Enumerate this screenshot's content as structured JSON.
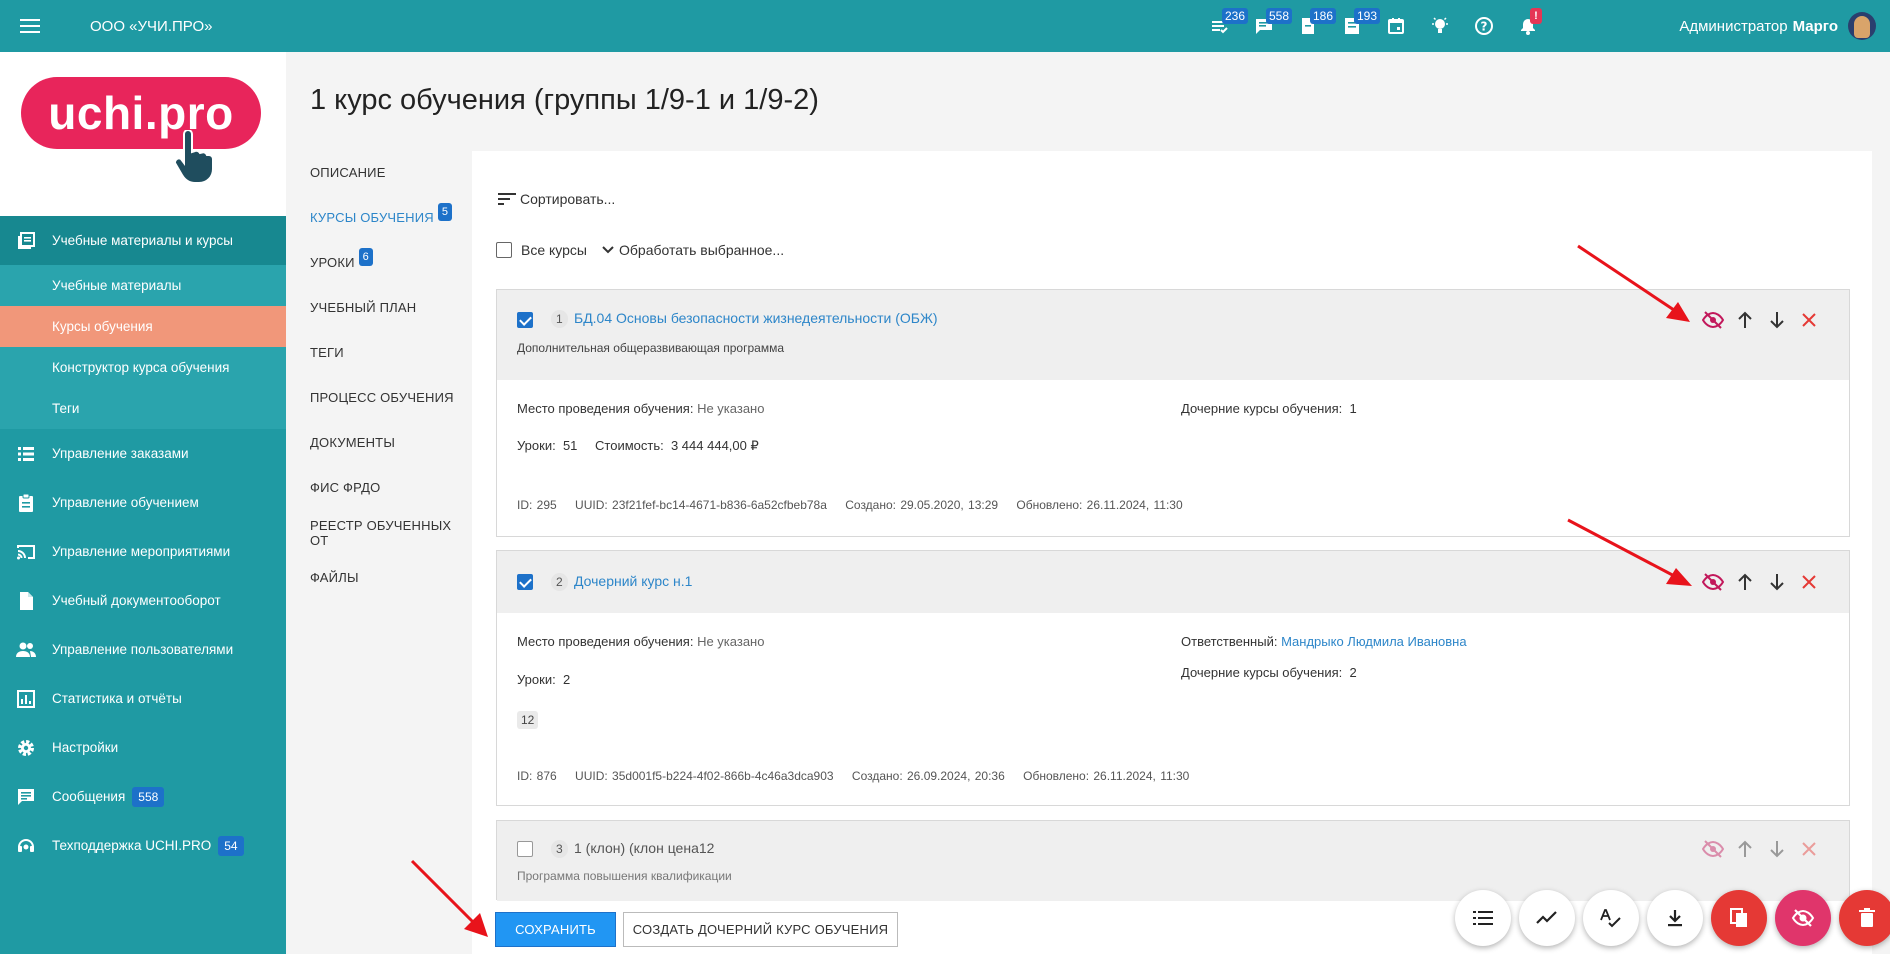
{
  "header": {
    "org": "ООО «УЧИ.ПРО»",
    "badges": {
      "a": "236",
      "b": "558",
      "c": "186",
      "d": "193",
      "notify": "!"
    },
    "user_role": "Администратор",
    "user_name": "Марго"
  },
  "logo": {
    "text": "uchi.pro"
  },
  "sidebar": {
    "main_section": "Учебные материалы и курсы",
    "sub_items": [
      "Учебные материалы",
      "Курсы обучения",
      "Конструктор курса обучения",
      "Теги"
    ],
    "items": [
      {
        "label": "Управление заказами"
      },
      {
        "label": "Управление обучением"
      },
      {
        "label": "Управление мероприятиями"
      },
      {
        "label": "Учебный документооборот"
      },
      {
        "label": "Управление пользователями"
      },
      {
        "label": "Статистика и отчёты"
      },
      {
        "label": "Настройки"
      },
      {
        "label": "Сообщения",
        "badge": "558"
      },
      {
        "label": "Техподдержка UCHI.PRO",
        "badge": "54"
      }
    ]
  },
  "page": {
    "title": "1 курс обучения (группы 1/9-1 и 1/9-2)",
    "tabs": [
      {
        "label": "ОПИСАНИЕ"
      },
      {
        "label": "КУРСЫ ОБУЧЕНИЯ",
        "badge": "5"
      },
      {
        "label": "УРОКИ",
        "badge": "6"
      },
      {
        "label": "УЧЕБНЫЙ ПЛАН"
      },
      {
        "label": "ТЕГИ"
      },
      {
        "label": "ПРОЦЕСС ОБУЧЕНИЯ"
      },
      {
        "label": "ДОКУМЕНТЫ"
      },
      {
        "label": "ФИС ФРДО"
      },
      {
        "label": "РЕЕСТР ОБУЧЕННЫХ ОТ"
      },
      {
        "label": "ФАЙЛЫ"
      }
    ]
  },
  "list": {
    "sort_label": "Сортировать...",
    "all_courses_label": "Все курсы",
    "process_label": "Обработать выбранное...",
    "cards": [
      {
        "num": "1",
        "title": "БД.04 Основы безопасности жизнедеятельности (ОБЖ)",
        "subtitle": "Дополнительная общеразвивающая программа",
        "place_label": "Место проведения обучения:",
        "place_value": "Не указано",
        "children_label": "Дочерние курсы обучения:",
        "children_value": "1",
        "lessons_label": "Уроки:",
        "lessons_value": "51",
        "cost_label": "Стоимость:",
        "cost_value": "3 444 444,00 ₽",
        "meta": {
          "id": "ID:  295",
          "uuid": "UUID:  23f21fef-bc14-4671-b836-6a52cfbeb78a",
          "created": "Создано: 29.05.2020, 13:29",
          "updated": "Обновлено: 26.11.2024, 11:30"
        }
      },
      {
        "num": "2",
        "title": "Дочерний курс н.1",
        "place_label": "Место проведения обучения:",
        "place_value": "Не указано",
        "responsible_label": "Ответственный:",
        "responsible_value": "Мандрыко Людмила Ивановна",
        "children_label": "Дочерние курсы обучения:",
        "children_value": "2",
        "lessons_label": "Уроки:",
        "lessons_value": "2",
        "chip": "12",
        "meta": {
          "id": "ID:  876",
          "uuid": "UUID:  35d001f5-b224-4f02-866b-4c46a3dca903",
          "created": "Создано: 26.09.2024, 20:36",
          "updated": "Обновлено: 26.11.2024, 11:30"
        }
      },
      {
        "num": "3",
        "title": "1 (клон) (клон цена12",
        "subtitle": "Программа повышения квалификации"
      }
    ]
  },
  "buttons": {
    "save": "СОХРАНИТЬ",
    "create_child": "СОЗДАТЬ ДОЧЕРНИЙ КУРС ОБУЧЕНИЯ"
  },
  "colors": {
    "accent": "#1f9aa3",
    "active_sub": "#f1977a",
    "link": "#2d86c9",
    "annotation_arrow": "#e8131b"
  }
}
